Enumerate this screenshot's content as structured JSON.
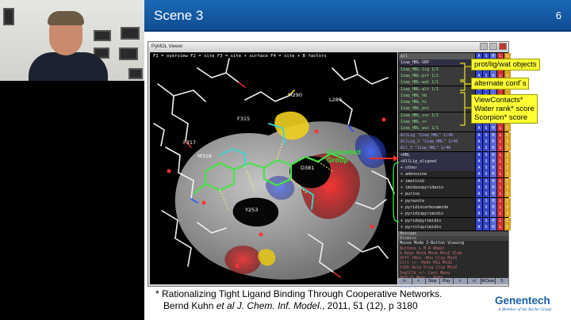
{
  "slide": {
    "title": "Scene 3",
    "number": "6"
  },
  "pymol": {
    "window_title": "PyMOL Viewer",
    "function_keys": "F1 = overview  F2 = site  F3 = site + surface  F4 = site + B factors",
    "residue_labels": [
      "M290",
      "L289",
      "F315",
      "F317",
      "M318",
      "D381",
      "Y253"
    ],
    "expanded_label": "Expanded\nGroup",
    "objects": [
      {
        "name": "all",
        "kind": "header"
      },
      {
        "name": "1iep_HBL-GRP",
        "kind": "group"
      },
      {
        "name": "1iep_HBL-lig 1/1",
        "kind": "obj"
      },
      {
        "name": "1iep_HBL-prt 1/1",
        "kind": "obj"
      },
      {
        "name": "1iep_HBL-wat 1/1",
        "kind": "obj"
      },
      {
        "name": "1iep_HBL-alt 1/1",
        "kind": "obj"
      },
      {
        "name": "1iep_HBL_hb",
        "kind": "obj"
      },
      {
        "name": "1iep_HBL_hc",
        "kind": "obj"
      },
      {
        "name": "1iep_HBL_pol",
        "kind": "obj"
      },
      {
        "name": "1iep_HBL_ssc 1/1",
        "kind": "obj"
      },
      {
        "name": "1iep_HBL_vc",
        "kind": "obj"
      },
      {
        "name": "1iep_HBL_wsc 1/1",
        "kind": "obj"
      },
      {
        "name": "AllLig \"1iep_HBL\" 1/46",
        "kind": "obj"
      },
      {
        "name": "AllLig_2 \"1iep_HBL\" 1/46",
        "kind": "obj"
      },
      {
        "name": "All_3 \"1iep_HBL\" 1/46",
        "kind": "obj"
      },
      {
        "name": "+HBL",
        "kind": "group"
      },
      {
        "name": "+AllLig_aligned",
        "kind": "group"
      },
      {
        "name": "+ other",
        "kind": "group"
      },
      {
        "name": "+ adenosine",
        "kind": "sub"
      },
      {
        "name": "+ imatinib",
        "kind": "sub"
      },
      {
        "name": "+ imidazopyridazin",
        "kind": "sub"
      },
      {
        "name": "+ purine",
        "kind": "sub"
      },
      {
        "name": "+ pyrazole",
        "kind": "sub"
      },
      {
        "name": "+ pyridincarboxamide",
        "kind": "sub"
      },
      {
        "name": "+ pyridinpyrimidin",
        "kind": "sub"
      },
      {
        "name": "+ pyridopyrimidin",
        "kind": "sub"
      },
      {
        "name": "+ pyrroloprimidin",
        "kind": "sub"
      }
    ],
    "button_letters": [
      "A",
      "S",
      "H",
      "L",
      "C"
    ],
    "command_lines": [
      "Message",
      "Dismiss",
      "Mouse Mode 3-Button Viewing",
      "Buttons  L    M    R  Wheel",
      " & Keys Rota Move MovZ Slab",
      "  Shft +Box -Box Clip MovS",
      "  Ctrl +/-  PkAt Pk1  MvSZ",
      "  CtSh Sele Orig Clip MovZ",
      "SnglClk +/-  Cent Menu",
      "DblClk Menu   -   PkAt",
      "Selecting Segments",
      "State  1/  1"
    ],
    "transport": [
      "|<",
      "<",
      "Stop",
      "Play",
      ">",
      ">|",
      "MClear",
      "S"
    ]
  },
  "callouts": {
    "prot": "prot/lig/wat objects",
    "alt": "alternate conf´s",
    "contacts": "ViewContacts*\nWater rank* score\nScorpion* score"
  },
  "citation": {
    "line1": "* Rationalizing Tight Ligand Binding Through Cooperative Networks.",
    "line2_a": "Bernd Kuhn ",
    "line2_b": "et al J. Chem. Inf. Model",
    "line2_c": "., 2011, 51 (12), p 3180"
  },
  "logo": {
    "word": "Genentech",
    "tagline": "A Member of the Roche Group"
  },
  "colors": {
    "header": "#1565b2",
    "callout": "#ffff33",
    "expanded": "#33dd33",
    "logo": "#1a5ea8"
  }
}
